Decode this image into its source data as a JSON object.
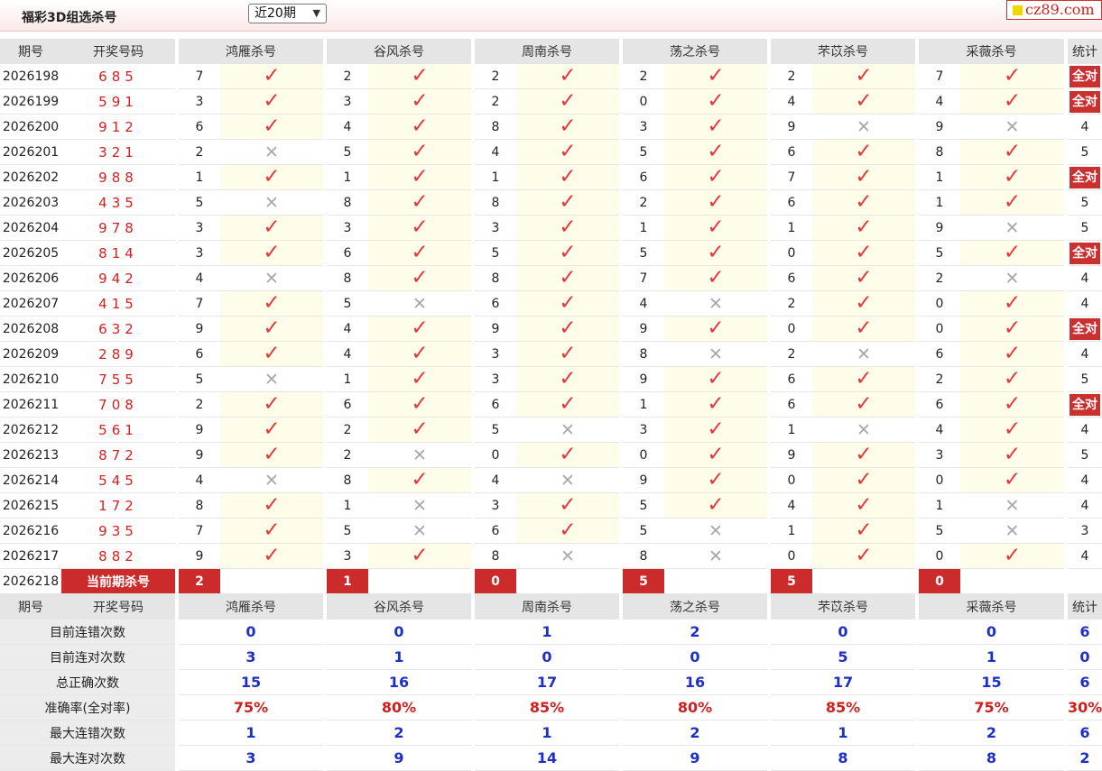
{
  "header": {
    "title": "福彩3D组选杀号",
    "range_select": "近20期",
    "range_arrow": "▼",
    "logo_text": "cz89.com"
  },
  "columns": {
    "issue": "期号",
    "drawn": "开奖号码",
    "experts": [
      "鸿雁杀号",
      "谷风杀号",
      "周南杀号",
      "荡之杀号",
      "芣苡杀号",
      "采薇杀号"
    ],
    "stat": "统计"
  },
  "symbols": {
    "hit": "✓",
    "miss": "✕"
  },
  "rows": [
    {
      "issue": "2026198",
      "drawn": "685",
      "kills": [
        "7",
        "2",
        "2",
        "2",
        "2",
        "7"
      ],
      "hits": [
        true,
        true,
        true,
        true,
        true,
        true
      ],
      "stat": "全对"
    },
    {
      "issue": "2026199",
      "drawn": "591",
      "kills": [
        "3",
        "3",
        "2",
        "0",
        "4",
        "4"
      ],
      "hits": [
        true,
        true,
        true,
        true,
        true,
        true
      ],
      "stat": "全对"
    },
    {
      "issue": "2026200",
      "drawn": "912",
      "kills": [
        "6",
        "4",
        "8",
        "3",
        "9",
        "9"
      ],
      "hits": [
        true,
        true,
        true,
        true,
        false,
        false
      ],
      "stat": "4"
    },
    {
      "issue": "2026201",
      "drawn": "321",
      "kills": [
        "2",
        "5",
        "4",
        "5",
        "6",
        "8"
      ],
      "hits": [
        false,
        true,
        true,
        true,
        true,
        true
      ],
      "stat": "5"
    },
    {
      "issue": "2026202",
      "drawn": "988",
      "kills": [
        "1",
        "1",
        "1",
        "6",
        "7",
        "1"
      ],
      "hits": [
        true,
        true,
        true,
        true,
        true,
        true
      ],
      "stat": "全对"
    },
    {
      "issue": "2026203",
      "drawn": "435",
      "kills": [
        "5",
        "8",
        "8",
        "2",
        "6",
        "1"
      ],
      "hits": [
        false,
        true,
        true,
        true,
        true,
        true
      ],
      "stat": "5"
    },
    {
      "issue": "2026204",
      "drawn": "978",
      "kills": [
        "3",
        "3",
        "3",
        "1",
        "1",
        "9"
      ],
      "hits": [
        true,
        true,
        true,
        true,
        true,
        false
      ],
      "stat": "5"
    },
    {
      "issue": "2026205",
      "drawn": "814",
      "kills": [
        "3",
        "6",
        "5",
        "5",
        "0",
        "5"
      ],
      "hits": [
        true,
        true,
        true,
        true,
        true,
        true
      ],
      "stat": "全对"
    },
    {
      "issue": "2026206",
      "drawn": "942",
      "kills": [
        "4",
        "8",
        "8",
        "7",
        "6",
        "2"
      ],
      "hits": [
        false,
        true,
        true,
        true,
        true,
        false
      ],
      "stat": "4"
    },
    {
      "issue": "2026207",
      "drawn": "415",
      "kills": [
        "7",
        "5",
        "6",
        "4",
        "2",
        "0"
      ],
      "hits": [
        true,
        false,
        true,
        false,
        true,
        true
      ],
      "stat": "4"
    },
    {
      "issue": "2026208",
      "drawn": "632",
      "kills": [
        "9",
        "4",
        "9",
        "9",
        "0",
        "0"
      ],
      "hits": [
        true,
        true,
        true,
        true,
        true,
        true
      ],
      "stat": "全对"
    },
    {
      "issue": "2026209",
      "drawn": "289",
      "kills": [
        "6",
        "4",
        "3",
        "8",
        "2",
        "6"
      ],
      "hits": [
        true,
        true,
        true,
        false,
        false,
        true
      ],
      "stat": "4"
    },
    {
      "issue": "2026210",
      "drawn": "755",
      "kills": [
        "5",
        "1",
        "3",
        "9",
        "6",
        "2"
      ],
      "hits": [
        false,
        true,
        true,
        true,
        true,
        true
      ],
      "stat": "5"
    },
    {
      "issue": "2026211",
      "drawn": "708",
      "kills": [
        "2",
        "6",
        "6",
        "1",
        "6",
        "6"
      ],
      "hits": [
        true,
        true,
        true,
        true,
        true,
        true
      ],
      "stat": "全对"
    },
    {
      "issue": "2026212",
      "drawn": "561",
      "kills": [
        "9",
        "2",
        "5",
        "3",
        "1",
        "4"
      ],
      "hits": [
        true,
        true,
        false,
        true,
        false,
        true
      ],
      "stat": "4"
    },
    {
      "issue": "2026213",
      "drawn": "872",
      "kills": [
        "9",
        "2",
        "0",
        "0",
        "9",
        "3"
      ],
      "hits": [
        true,
        false,
        true,
        true,
        true,
        true
      ],
      "stat": "5"
    },
    {
      "issue": "2026214",
      "drawn": "545",
      "kills": [
        "4",
        "8",
        "4",
        "9",
        "0",
        "0"
      ],
      "hits": [
        false,
        true,
        false,
        true,
        true,
        true
      ],
      "stat": "4"
    },
    {
      "issue": "2026215",
      "drawn": "172",
      "kills": [
        "8",
        "1",
        "3",
        "5",
        "4",
        "1"
      ],
      "hits": [
        true,
        false,
        true,
        true,
        true,
        false
      ],
      "stat": "4"
    },
    {
      "issue": "2026216",
      "drawn": "935",
      "kills": [
        "7",
        "5",
        "6",
        "5",
        "1",
        "5"
      ],
      "hits": [
        true,
        false,
        true,
        false,
        true,
        false
      ],
      "stat": "3"
    },
    {
      "issue": "2026217",
      "drawn": "882",
      "kills": [
        "9",
        "3",
        "8",
        "8",
        "0",
        "0"
      ],
      "hits": [
        true,
        true,
        false,
        false,
        true,
        true
      ],
      "stat": "4"
    }
  ],
  "current": {
    "issue": "2026218",
    "label": "当前期杀号",
    "kills": [
      "2",
      "1",
      "0",
      "5",
      "5",
      "0"
    ]
  },
  "summary_header": {
    "issue": "期号",
    "drawn": "开奖号码",
    "experts": [
      "鸿雁杀号",
      "谷风杀号",
      "周南杀号",
      "荡之杀号",
      "芣苡杀号",
      "采薇杀号"
    ],
    "stat": "统计"
  },
  "summary": [
    {
      "label": "目前连错次数",
      "values": [
        "0",
        "0",
        "1",
        "2",
        "0",
        "0"
      ],
      "stat": "6",
      "red": false
    },
    {
      "label": "目前连对次数",
      "values": [
        "3",
        "1",
        "0",
        "0",
        "5",
        "1"
      ],
      "stat": "0",
      "red": false
    },
    {
      "label": "总正确次数",
      "values": [
        "15",
        "16",
        "17",
        "16",
        "17",
        "15"
      ],
      "stat": "6",
      "red": false
    },
    {
      "label": "准确率(全对率)",
      "values": [
        "75%",
        "80%",
        "85%",
        "80%",
        "85%",
        "75%"
      ],
      "stat": "30%",
      "red": true
    },
    {
      "label": "最大连错次数",
      "values": [
        "1",
        "2",
        "1",
        "2",
        "1",
        "2"
      ],
      "stat": "6",
      "red": false
    },
    {
      "label": "最大连对次数",
      "values": [
        "3",
        "9",
        "14",
        "9",
        "8",
        "8"
      ],
      "stat": "2",
      "red": false
    }
  ],
  "colors": {
    "accent_red": "#cc2b2b",
    "check_red": "#e8343a",
    "blue_value": "#1e2fc8",
    "hit_cell_bg": "#fdfde9",
    "header_bg": "#e5e5e5"
  }
}
